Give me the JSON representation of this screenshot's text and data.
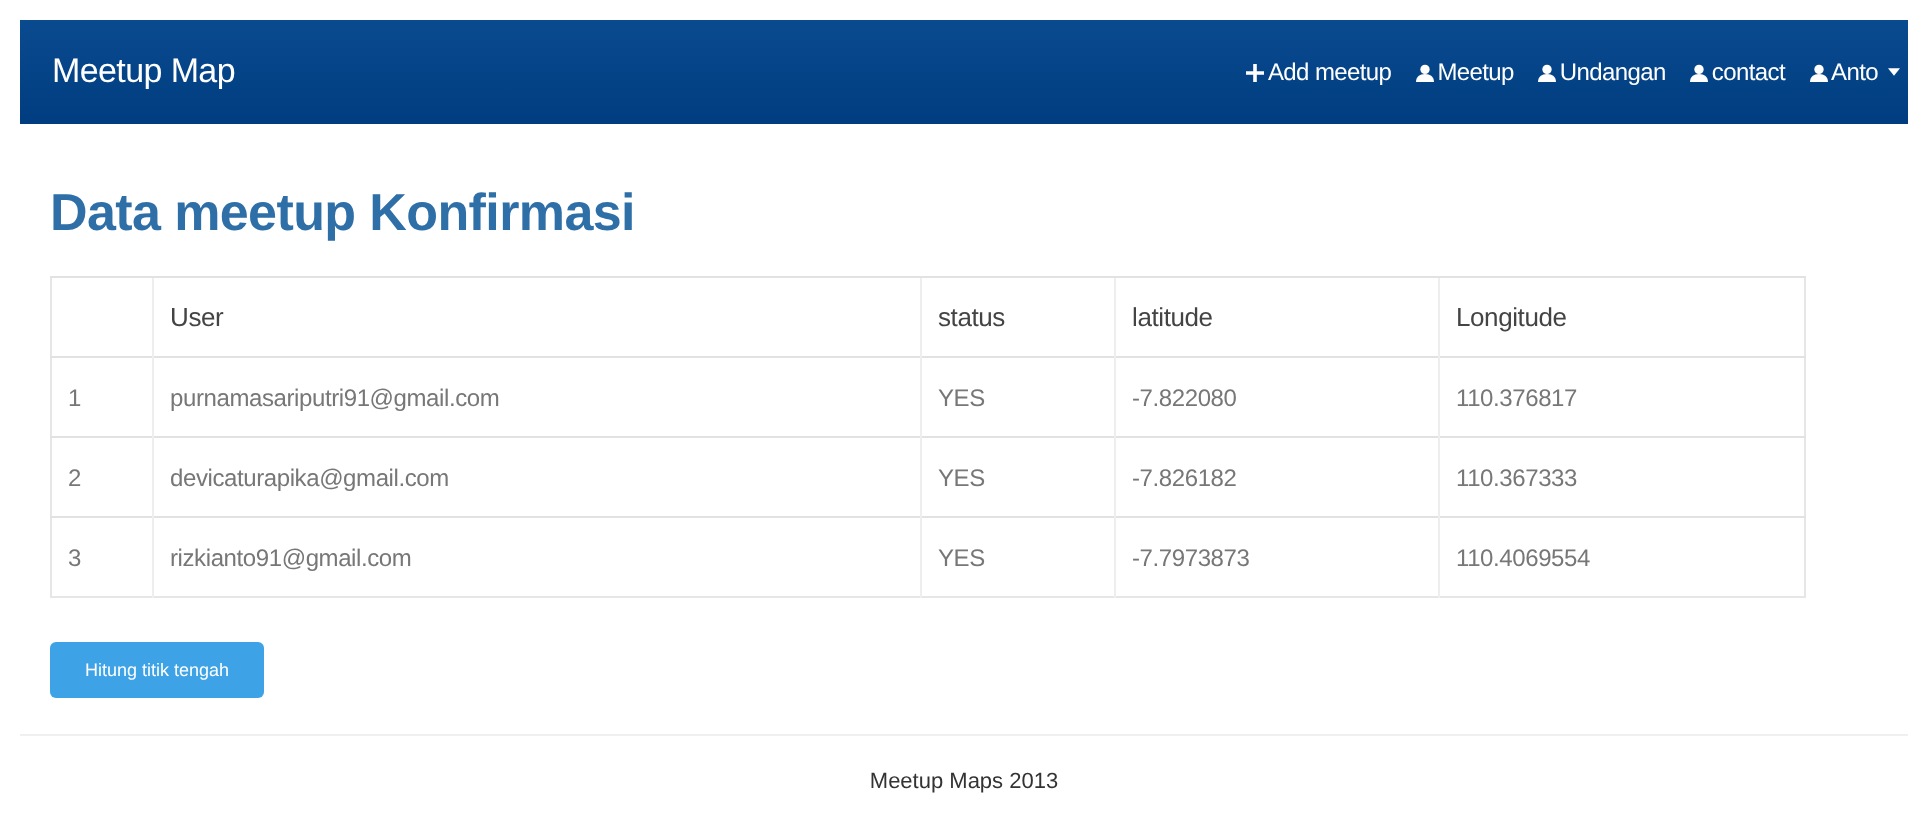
{
  "navbar": {
    "brand": "Meetup Map",
    "items": [
      {
        "kind": "add",
        "label": "Add meetup"
      },
      {
        "kind": "user",
        "label": "Meetup"
      },
      {
        "kind": "user",
        "label": "Undangan"
      },
      {
        "kind": "user",
        "label": "contact"
      },
      {
        "kind": "account",
        "label": "Anto"
      }
    ]
  },
  "heading": "Data meetup Konfirmasi",
  "table": {
    "columns": [
      "",
      "User",
      "status",
      "latitude",
      "Longitude"
    ],
    "rows": [
      [
        "1",
        "purnamasariputri91@gmail.com",
        "YES",
        "-7.822080",
        "110.376817"
      ],
      [
        "2",
        "devicaturapika@gmail.com",
        "YES",
        "-7.826182",
        "110.367333"
      ],
      [
        "3",
        "rizkianto91@gmail.com",
        "YES",
        "-7.7973873",
        "110.4069554"
      ]
    ]
  },
  "button": "Hitung titik tengah",
  "footer": "Meetup Maps 2013"
}
